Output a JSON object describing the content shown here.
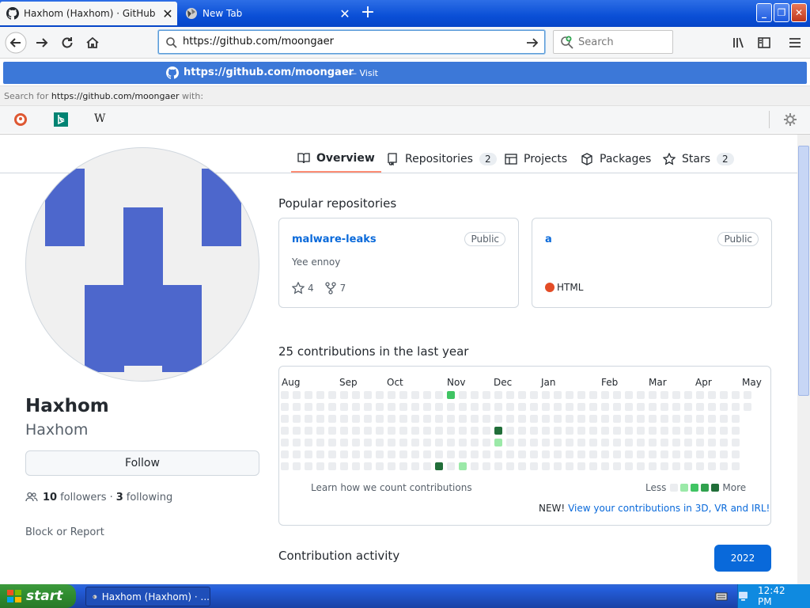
{
  "tabs": [
    {
      "title": "Haxhom (Haxhom) · GitHub",
      "active": true
    },
    {
      "title": "New Tab",
      "active": false
    }
  ],
  "nav": {
    "url": "https://github.com/moongaer",
    "search_placeholder": "Search"
  },
  "suggestion": {
    "url": "https://github.com/moongaer",
    "action": "— Visit",
    "search_for_prefix": "Search for",
    "search_for_url": "https://github.com/moongaer",
    "search_for_suffix": "with:",
    "engines": [
      "duckduckgo-icon",
      "bing-icon",
      "wikipedia-icon"
    ]
  },
  "profile": {
    "name": "Haxhom",
    "login": "Haxhom",
    "follow_label": "Follow",
    "followers_count": "10",
    "followers_label": "followers",
    "following_count": "3",
    "following_label": "following",
    "separator": "·",
    "block_report": "Block or Report"
  },
  "profile_tabs": [
    {
      "label": "Overview",
      "icon": "book-icon",
      "count": ""
    },
    {
      "label": "Repositories",
      "icon": "repo-icon",
      "count": "2"
    },
    {
      "label": "Projects",
      "icon": "project-icon",
      "count": ""
    },
    {
      "label": "Packages",
      "icon": "package-icon",
      "count": ""
    },
    {
      "label": "Stars",
      "icon": "star-icon",
      "count": "2"
    }
  ],
  "popular": {
    "title": "Popular repositories",
    "repos": [
      {
        "name": "malware-leaks",
        "visibility": "Public",
        "description": "Yee ennoy",
        "stars": "4",
        "forks": "7",
        "language": ""
      },
      {
        "name": "a",
        "visibility": "Public",
        "description": "",
        "stars": "",
        "forks": "",
        "language": "HTML",
        "language_color": "#e34c26"
      }
    ]
  },
  "contributions": {
    "title": "25 contributions in the last year",
    "months": [
      "Aug",
      "Sep",
      "Oct",
      "Nov",
      "Dec",
      "Jan",
      "Feb",
      "Mar",
      "Apr",
      "May"
    ],
    "learn_link": "Learn how we count contributions",
    "less": "Less",
    "more": "More",
    "new_prefix": "NEW!",
    "new_link": "View your contributions in 3D, VR and IRL!",
    "colors": [
      "#ebedf0",
      "#9be9a8",
      "#40c463",
      "#30a14e",
      "#216e39"
    ]
  },
  "activity": {
    "title": "Contribution activity",
    "year": "2022"
  },
  "taskbar": {
    "start": "start",
    "item": "Haxhom (Haxhom) · ...",
    "clock": "12:42 PM"
  }
}
